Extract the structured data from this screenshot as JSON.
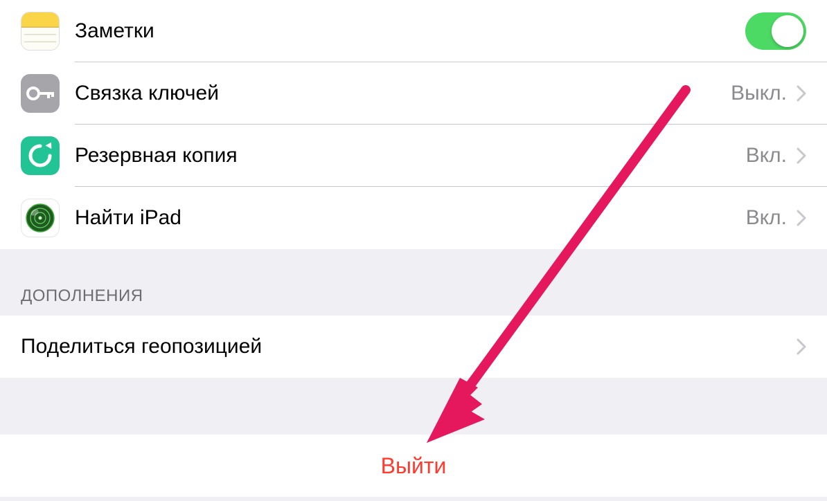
{
  "icloud_items": [
    {
      "id": "notes",
      "label": "Заметки",
      "toggle_on": true
    },
    {
      "id": "keychain",
      "label": "Связка ключей",
      "value": "Выкл."
    },
    {
      "id": "backup",
      "label": "Резервная копия",
      "value": "Вкл."
    },
    {
      "id": "find",
      "label": "Найти iPad",
      "value": "Вкл."
    }
  ],
  "extensions": {
    "header": "ДОПОЛНЕНИЯ",
    "share_location": "Поделиться геопозицией"
  },
  "signout": "Выйти",
  "colors": {
    "switch_on": "#4cd964",
    "destructive": "#ff3b30",
    "section_bg": "#efeff4",
    "annotation": "#e6185d"
  }
}
